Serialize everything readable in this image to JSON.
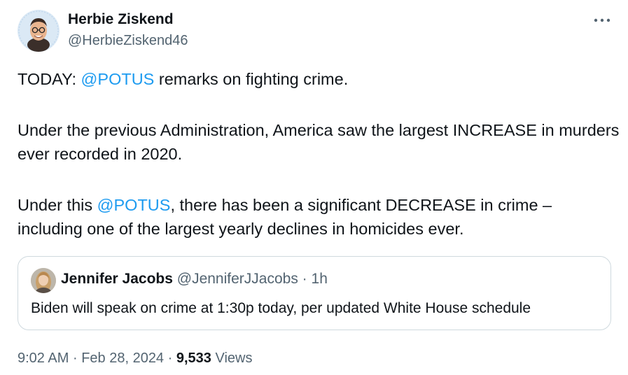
{
  "author": {
    "name": "Herbie Ziskend",
    "handle": "@HerbieZiskend46"
  },
  "more_icon": "more-horizontal-icon",
  "tweet": {
    "line1_prefix": "TODAY: ",
    "mention1": "@POTUS",
    "line1_suffix": " remarks on fighting crime.",
    "para2": "Under the previous Administration, America saw the largest INCREASE in murders ever recorded in 2020.",
    "para3_prefix": "Under this ",
    "mention2": "@POTUS",
    "para3_suffix": ", there has been a significant DECREASE in crime – including one of the largest yearly declines in homicides ever."
  },
  "quote": {
    "name": "Jennifer Jacobs",
    "handle": "@JenniferJJacobs",
    "separator": "·",
    "time": "1h",
    "text": "Biden will speak on crime at 1:30p today, per updated White House schedule"
  },
  "meta": {
    "time": "9:02 AM",
    "sep1": "·",
    "date": "Feb 28, 2024",
    "sep2": "·",
    "views_count": "9,533",
    "views_label": "Views"
  },
  "colors": {
    "link": "#1d9bf0",
    "secondary_text": "#536471",
    "primary_text": "#0f1419",
    "border": "#cfd9de"
  }
}
